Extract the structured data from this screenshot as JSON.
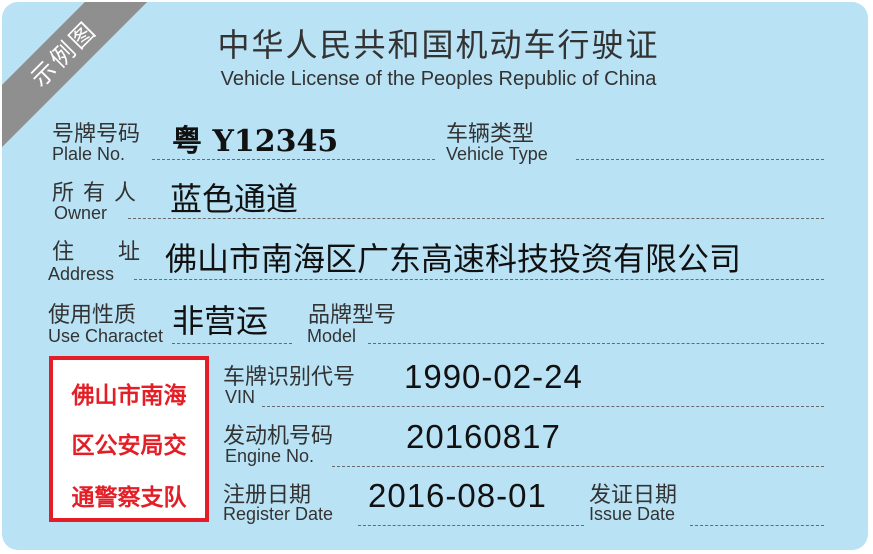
{
  "sample_badge": "示例图",
  "title": {
    "cn": "中华人民共和国机动车行驶证",
    "en": "Vehicle License of the Peoples Republic of China"
  },
  "fields": {
    "plate_no": {
      "cn": "号牌号码",
      "en": "Plale No.",
      "value": "粤 Y12345"
    },
    "vehicle_type": {
      "cn": "车辆类型",
      "en": "Vehicle Type",
      "value": ""
    },
    "owner": {
      "cn": "所 有 人",
      "en": "Owner",
      "value": "蓝色通道"
    },
    "address": {
      "cn": "住　　址",
      "en": "Address",
      "value": "佛山市南海区广东高速科技投资有限公司"
    },
    "use_character": {
      "cn": "使用性质",
      "en": "Use Charactet",
      "value": "非营运"
    },
    "model": {
      "cn": "品牌型号",
      "en": "Model",
      "value": ""
    },
    "vin": {
      "cn": "车牌识别代号",
      "en": "VIN",
      "value": "1990-02-24"
    },
    "engine_no": {
      "cn": "发动机号码",
      "en": "Engine No.",
      "value": "20160817"
    },
    "register_date": {
      "cn": "注册日期",
      "en": "Register Date",
      "value": "2016-08-01"
    },
    "issue_date": {
      "cn": "发证日期",
      "en": "Issue Date",
      "value": ""
    }
  },
  "seal": {
    "lines": [
      "佛山市南海",
      "区公安局交",
      "通警察支队"
    ]
  },
  "colors": {
    "card_background": "#b9e2f5",
    "seal_red": "#e41e26",
    "badge_gray": "#8f8f8f"
  }
}
